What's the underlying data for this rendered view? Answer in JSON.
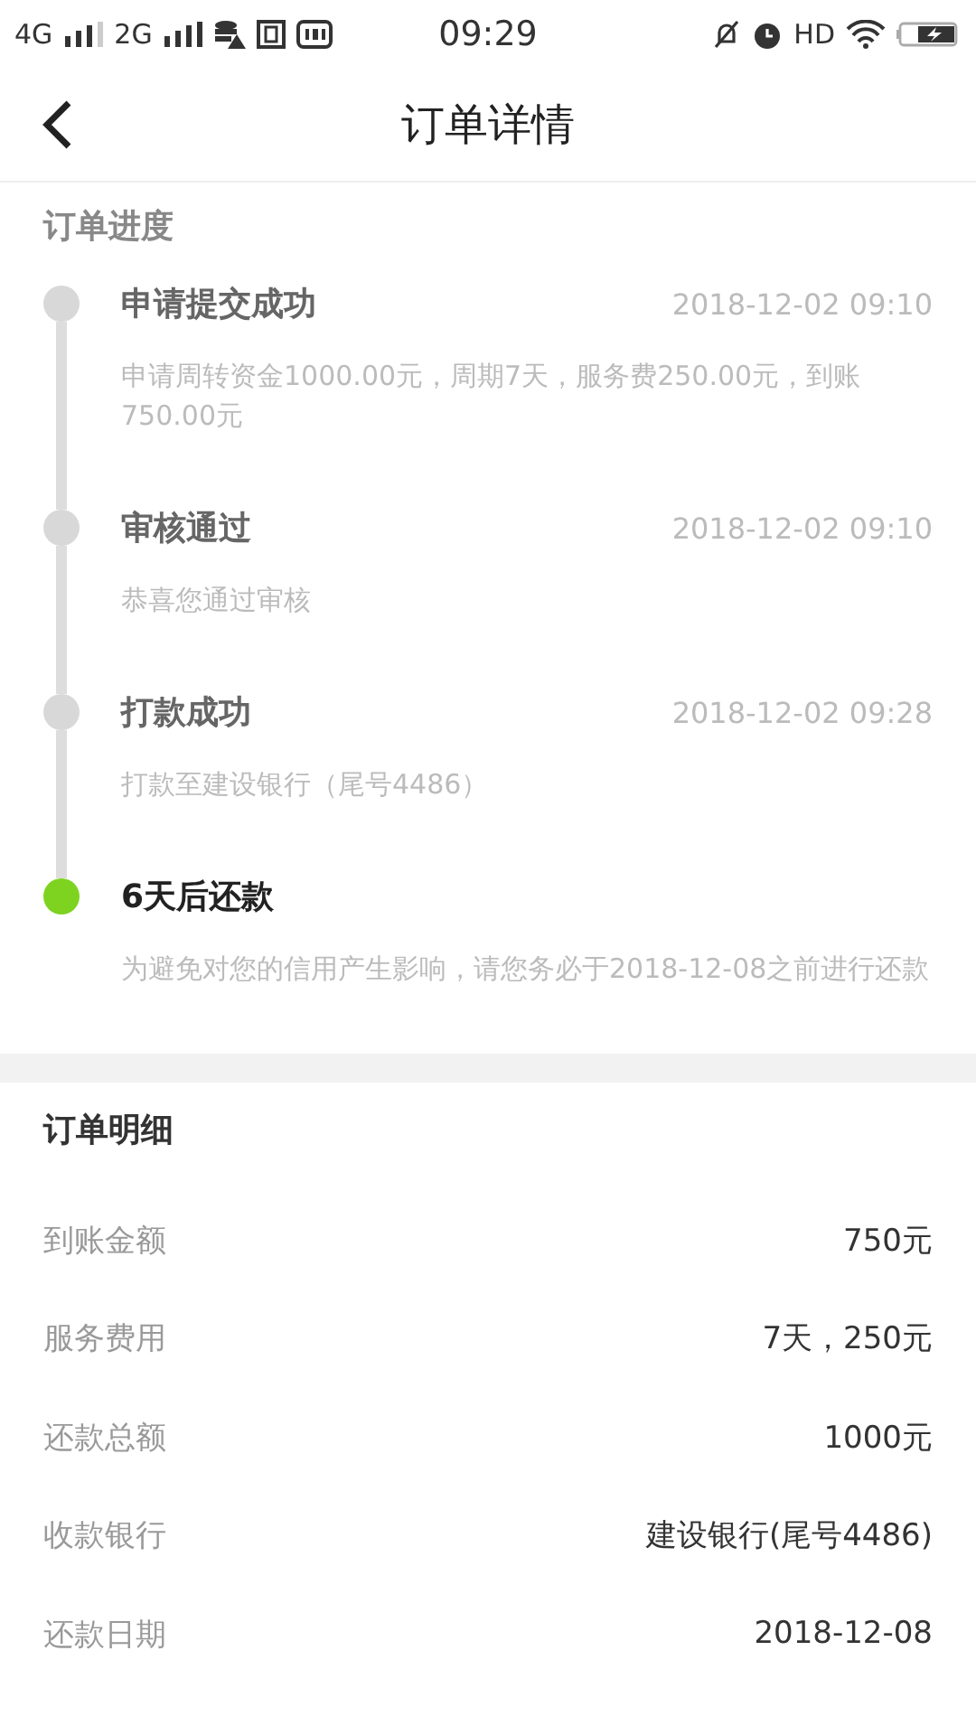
{
  "status_bar": {
    "network_1": "4G",
    "network_2": "2G",
    "time": "09:29",
    "hd": "HD"
  },
  "header": {
    "title": "订单详情"
  },
  "progress": {
    "title": "订单进度",
    "steps": [
      {
        "title": "申请提交成功",
        "time": "2018-12-02 09:10",
        "description": "申请周转资金1000.00元，周期7天，服务费250.00元，到账750.00元",
        "current": false
      },
      {
        "title": "审核通过",
        "time": "2018-12-02 09:10",
        "description": "恭喜您通过审核",
        "current": false
      },
      {
        "title": "打款成功",
        "time": "2018-12-02 09:28",
        "description": "打款至建设银行（尾号4486）",
        "current": false
      },
      {
        "title": "6天后还款",
        "description": "为避免对您的信用产生影响，请您务必于2018-12-08之前进行还款",
        "current": true
      }
    ]
  },
  "details": {
    "title": "订单明细",
    "rows": [
      {
        "label": "到账金额",
        "value": "750元"
      },
      {
        "label": "服务费用",
        "value": "7天，250元"
      },
      {
        "label": "还款总额",
        "value": "1000元"
      },
      {
        "label": "收款银行",
        "value": "建设银行(尾号4486)"
      },
      {
        "label": "还款日期",
        "value": "2018-12-08"
      }
    ]
  }
}
